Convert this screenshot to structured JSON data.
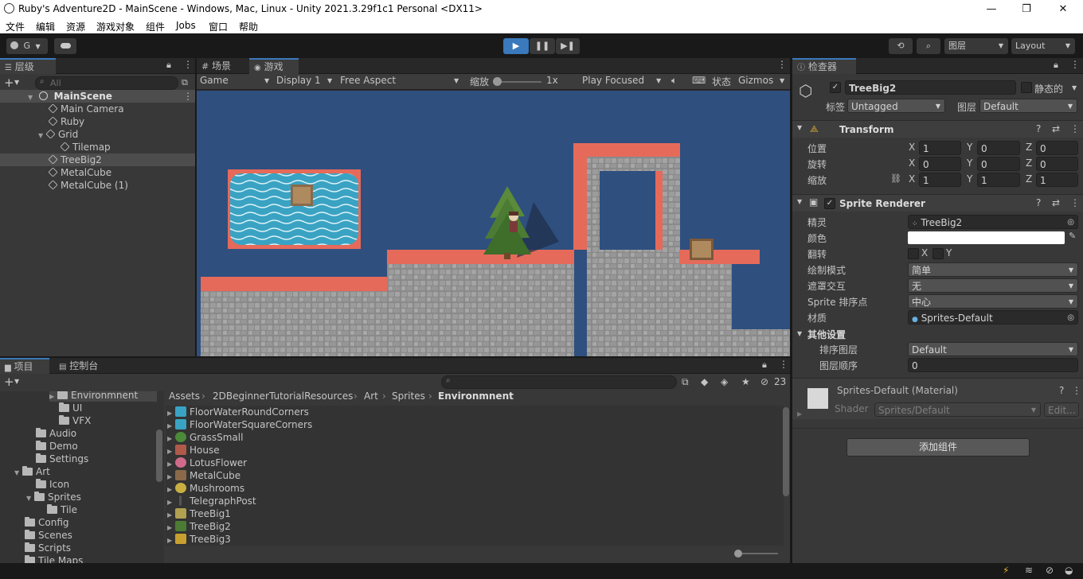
{
  "window": {
    "title": "Ruby's Adventure2D - MainScene - Windows, Mac, Linux - Unity 2021.3.29f1c1 Personal <DX11>",
    "min": "—",
    "max": "❐",
    "close": "✕"
  },
  "menu": [
    "文件",
    "编辑",
    "资源",
    "游戏对象",
    "组件",
    "Jobs",
    "窗口",
    "帮助"
  ],
  "toolbar": {
    "account": "G",
    "play": "▶",
    "pause": "❚❚",
    "step": "▶❚",
    "layers": "图层",
    "layout": "Layout"
  },
  "hierarchy": {
    "tab": "层级",
    "search_placeholder": "All",
    "scene": "MainScene",
    "items": [
      {
        "name": "Main Camera",
        "depth": 1
      },
      {
        "name": "Ruby",
        "depth": 1
      },
      {
        "name": "Grid",
        "depth": 1
      },
      {
        "name": "Tilemap",
        "depth": 2
      },
      {
        "name": "TreeBig2",
        "depth": 1
      },
      {
        "name": "MetalCube",
        "depth": 1
      },
      {
        "name": "MetalCube (1)",
        "depth": 1
      }
    ]
  },
  "game": {
    "tabs": [
      "场景",
      "游戏"
    ],
    "mode": "Game",
    "display": "Display 1",
    "aspect": "Free Aspect",
    "scale_label": "缩放",
    "scale_value": "1x",
    "play_focused": "Play Focused",
    "stats": "状态",
    "gizmos": "Gizmos"
  },
  "project": {
    "tabs": [
      "项目",
      "控制台"
    ],
    "hidden_count": "23",
    "tree": [
      "Environmnent",
      "UI",
      "VFX",
      "Audio",
      "Demo",
      "Settings",
      "Art",
      "Icon",
      "Sprites",
      "Tile",
      "Config",
      "Scenes",
      "Scripts",
      "Tile Maps"
    ],
    "breadcrumb": [
      "Assets",
      "2DBeginnerTutorialResources",
      "Art",
      "Sprites",
      "Environmnent"
    ],
    "assets": [
      "FloorWaterRoundCorners",
      "FloorWaterSquareCorners",
      "GrassSmall",
      "House",
      "LotusFlower",
      "MetalCube",
      "Mushrooms",
      "TelegraphPost",
      "TreeBig1",
      "TreeBig2",
      "TreeBig3"
    ]
  },
  "inspector": {
    "tab": "检查器",
    "object_name": "TreeBig2",
    "static_label": "静态的",
    "tag_label": "标签",
    "tag_value": "Untagged",
    "layer_label": "图层",
    "layer_value": "Default",
    "transform": {
      "title": "Transform",
      "position_label": "位置",
      "rotation_label": "旋转",
      "scale_label": "缩放",
      "position": [
        "1",
        "0",
        "0"
      ],
      "rotation": [
        "0",
        "0",
        "0"
      ],
      "scale": [
        "1",
        "1",
        "1"
      ],
      "axes": [
        "X",
        "Y",
        "Z"
      ]
    },
    "sprite_renderer": {
      "title": "Sprite Renderer",
      "sprite_label": "精灵",
      "sprite_value": "TreeBig2",
      "color_label": "颜色",
      "flip_label": "翻转",
      "flip_x": "X",
      "flip_y": "Y",
      "draw_mode_label": "绘制模式",
      "draw_mode_value": "简单",
      "mask_label": "遮罩交互",
      "mask_value": "无",
      "pivot_label": "Sprite 排序点",
      "pivot_value": "中心",
      "material_label": "材质",
      "material_value": "Sprites-Default",
      "other_label": "其他设置",
      "sort_layer_label": "排序图层",
      "sort_layer_value": "Default",
      "order_label": "图层顺序",
      "order_value": "0"
    },
    "material": {
      "name": "Sprites-Default (Material)",
      "shader_label": "Shader",
      "shader_value": "Sprites/Default",
      "edit": "Edit..."
    },
    "add_component": "添加组件"
  },
  "colors": {
    "accent": "#3a79bb",
    "scene_bg": "#2f4f7f",
    "path": "#e66a5a",
    "water": "#3aa3c3"
  }
}
